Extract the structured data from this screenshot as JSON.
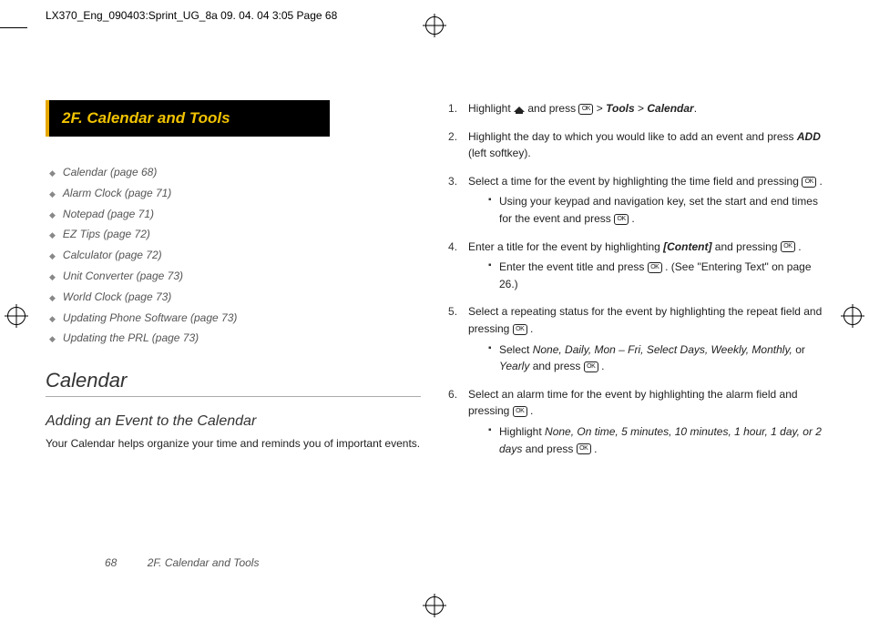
{
  "header": {
    "job_line": "LX370_Eng_090403:Sprint_UG_8a  09. 04. 04    3:05  Page 68"
  },
  "section_title": "2F.   Calendar and Tools",
  "toc": [
    "Calendar (page 68)",
    "Alarm Clock (page 71)",
    "Notepad (page 71)",
    "EZ Tips (page 72)",
    "Calculator (page 72)",
    "Unit Converter (page 73)",
    "World Clock (page 73)",
    "Updating Phone Software (page 73)",
    "Updating the PRL (page 73)"
  ],
  "h1": "Calendar",
  "h2": "Adding an Event to the Calendar",
  "intro": "Your Calendar helps organize your time and reminds you of important events.",
  "footer": {
    "page_number": "68",
    "running": "2F. Calendar and Tools"
  },
  "steps": {
    "s1_a": "Highlight ",
    "s1_b": " and press ",
    "s1_c": " > ",
    "s1_tools": "Tools",
    "s1_gt": " > ",
    "s1_cal": "Calendar",
    "s1_end": ".",
    "s2_a": "Highlight the day to which you would like to add an event and press ",
    "s2_add": "ADD",
    "s2_b": " (left softkey).",
    "s3_a": "Select a time for the event by highlighting the time field and pressing ",
    "s3_end": " .",
    "s3_sub_a": "Using your keypad and navigation key, set the start and end times for the event and press ",
    "s3_sub_end": " .",
    "s4_a": "Enter a title for the event by highlighting ",
    "s4_content": "[Content]",
    "s4_b": " and pressing ",
    "s4_end": " .",
    "s4_sub_a": "Enter the event title and press ",
    "s4_sub_b": " . (See \"Entering Text\" on page 26.)",
    "s5_a": "Select a repeating status for the event by highlighting the repeat field and pressing ",
    "s5_end": " .",
    "s5_sub_a": "Select ",
    "s5_opts": "None, Daily, Mon – Fri, Select Days, Weekly, Monthly,",
    "s5_or": " or ",
    "s5_yearly": "Yearly",
    "s5_sub_b": " and press ",
    "s5_sub_end": " .",
    "s6_a": "Select an alarm time for the event by highlighting the alarm field and pressing ",
    "s6_end": " .",
    "s6_sub_a": "Highlight ",
    "s6_opts": "None, On time, 5 minutes, 10 minutes, 1 hour, 1 day, or 2 days",
    "s6_sub_b": " and press ",
    "s6_sub_end": " ."
  }
}
